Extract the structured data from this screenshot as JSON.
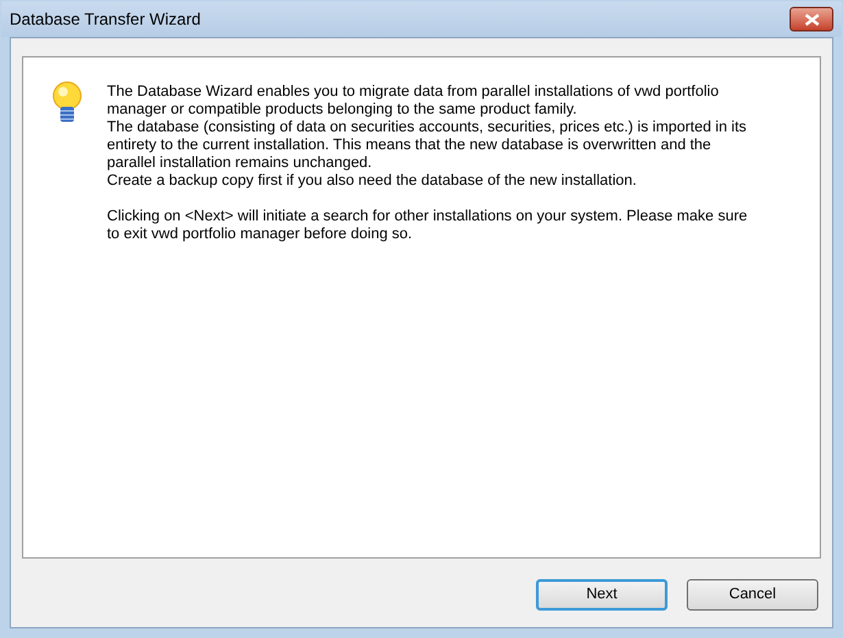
{
  "window": {
    "title": "Database Transfer Wizard"
  },
  "paragraphs": [
    "The Database Wizard enables you to migrate data from parallel installations of vwd portfolio manager or compatible products belonging to the same product family.",
    "The database (consisting of data on securities accounts, securities, prices etc.) is imported in its entirety to the current installation. This means that the new database is overwritten and the parallel installation remains unchanged.",
    "Create a backup copy first if you also need the database of the new installation.",
    "Clicking on <Next> will initiate a search for other installations on your system. Please make sure to exit vwd portfolio manager before doing so."
  ],
  "buttons": [
    {
      "label": "Next",
      "default": true
    },
    {
      "label": "Cancel",
      "default": false
    }
  ]
}
